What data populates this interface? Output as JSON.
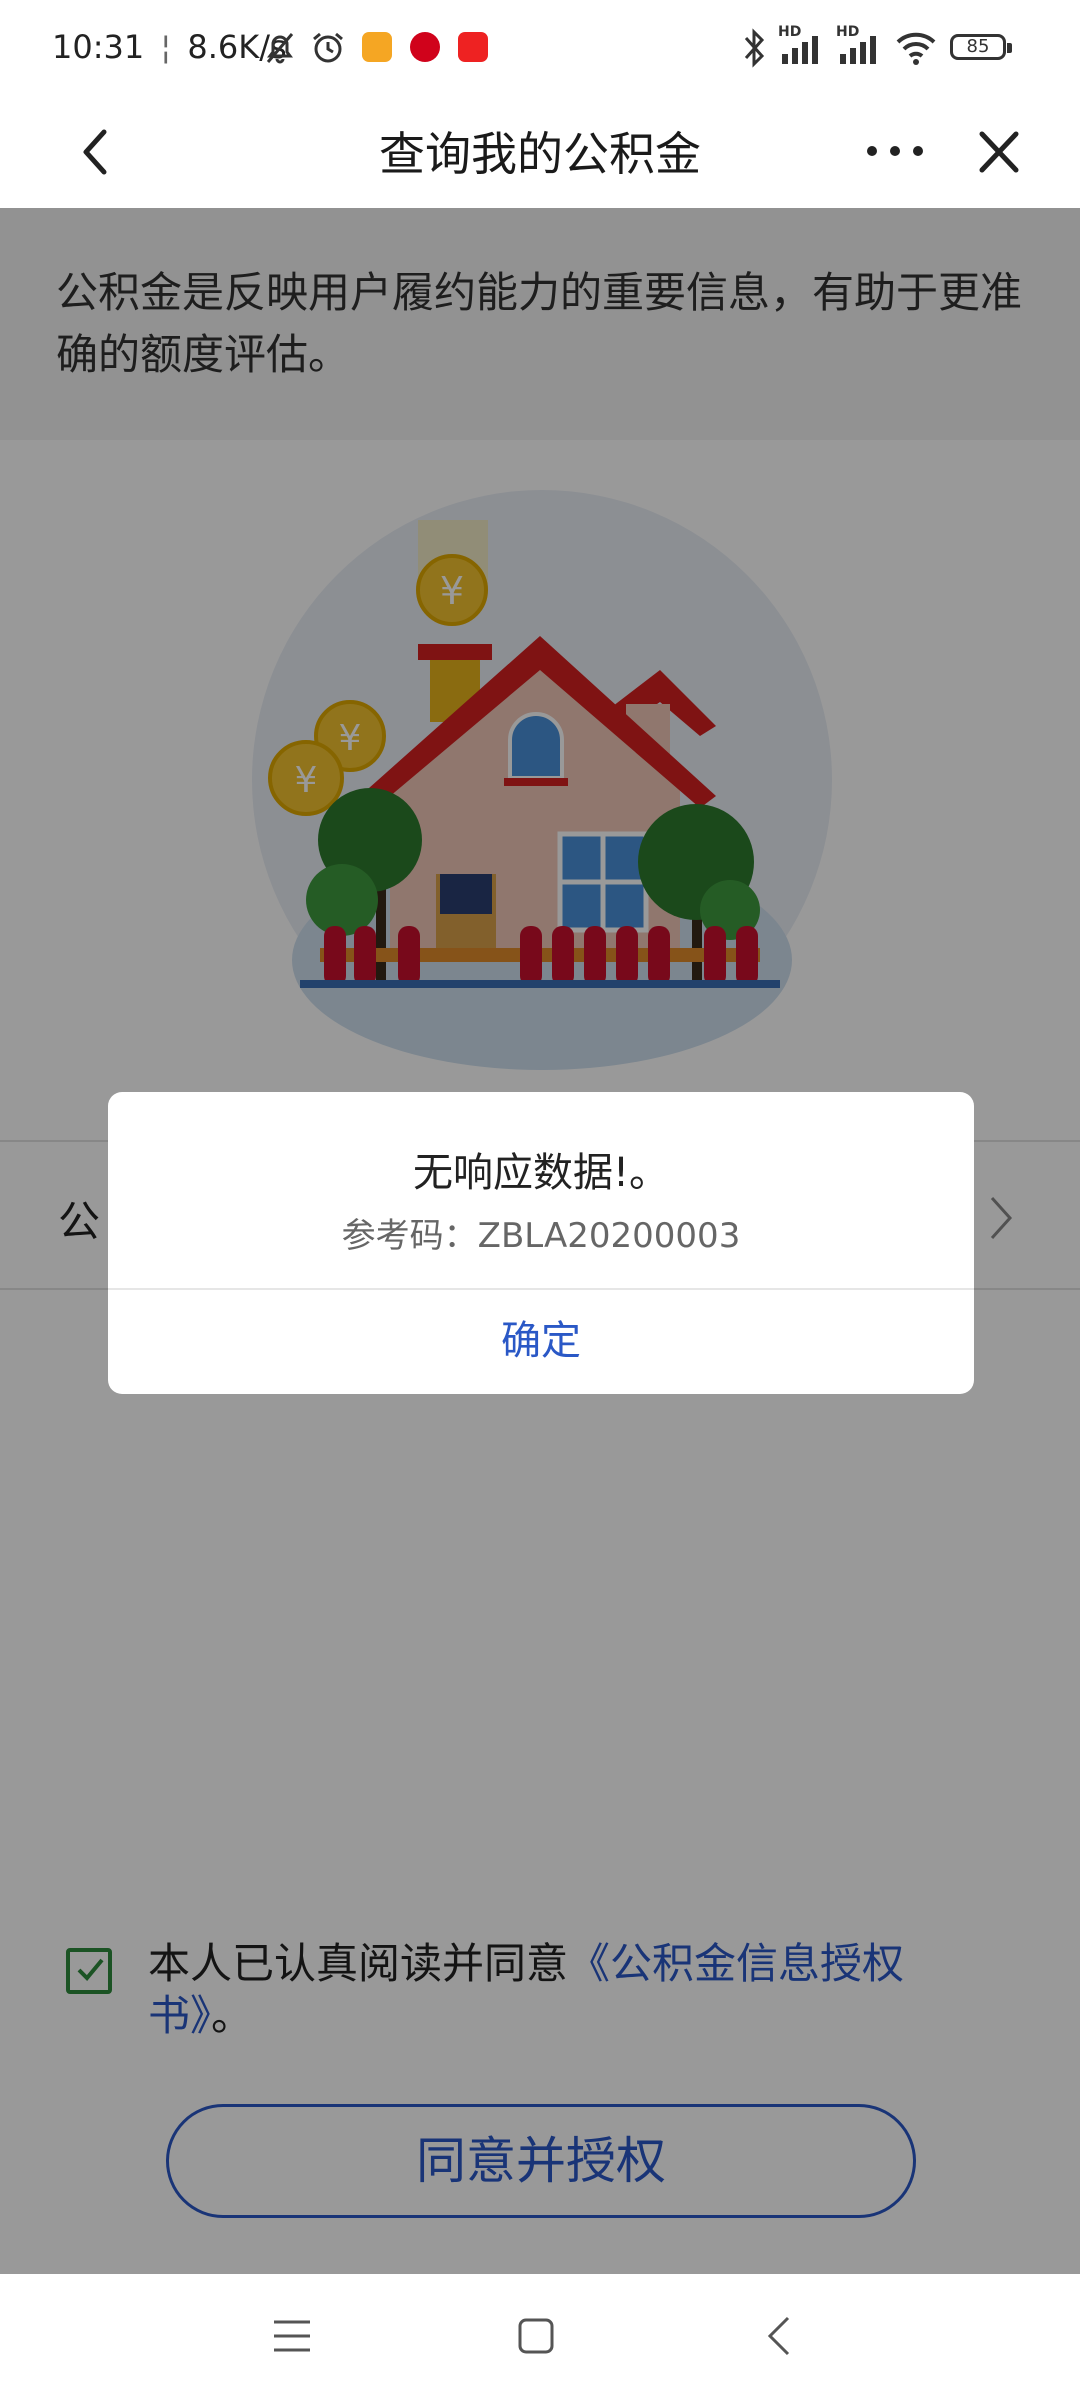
{
  "status_bar": {
    "time": "10:31",
    "net_speed": "8.6K/s",
    "battery": "85",
    "signal_tag_1": "HD",
    "signal_tag_2": "HD"
  },
  "nav": {
    "title": "查询我的公积金",
    "back_icon": "chevron-left-icon",
    "more_icon": "more-horizontal-icon",
    "close_icon": "close-icon"
  },
  "intro": {
    "text": "公积金是反映用户履约能力的重要信息，有助于更准确的额度评估。"
  },
  "row": {
    "label": "公"
  },
  "agreement": {
    "prefix": "本人已认真阅读并同意",
    "link": "《公积金信息授权书》",
    "suffix": "。",
    "button_label": "同意并授权"
  },
  "dialog": {
    "title": "无响应数据!。",
    "code": "参考码：ZBLA20200003",
    "ok_label": "确定"
  },
  "colors": {
    "accent": "#2a58c6",
    "check": "#2e8b3c",
    "roof": "#d42020",
    "coin": "#f2c230"
  }
}
